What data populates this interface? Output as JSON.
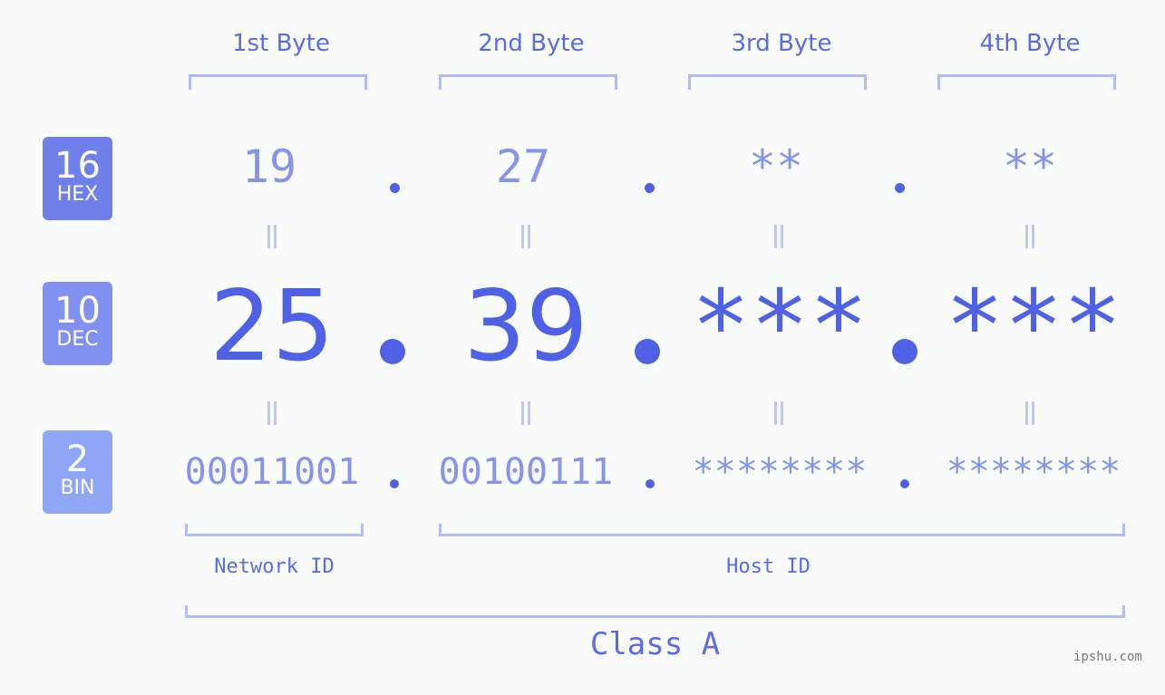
{
  "bases": [
    {
      "num": "16",
      "label": "HEX",
      "color": "#6f80ea"
    },
    {
      "num": "10",
      "label": "DEC",
      "color": "#8291ef"
    },
    {
      "num": "2",
      "label": "BIN",
      "color": "#8fa6f6"
    }
  ],
  "byte_headers": [
    "1st Byte",
    "2nd Byte",
    "3rd Byte",
    "4th Byte"
  ],
  "hex": [
    "19",
    "27",
    "**",
    "**"
  ],
  "dec": [
    "25",
    "39",
    "***",
    "***"
  ],
  "bin": [
    "00011001",
    "00100111",
    "********",
    "********"
  ],
  "separator": ".",
  "network_label": "Network ID",
  "host_label": "Host ID",
  "class_label": "Class A",
  "watermark": "ipshu.com",
  "colors": {
    "primary": "#4f62e6",
    "light": "#8893ec",
    "bracket": "#b3bcf4"
  }
}
